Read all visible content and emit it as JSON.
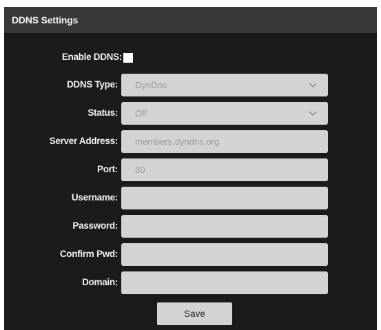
{
  "header": {
    "title": "DDNS Settings"
  },
  "form": {
    "enable_ddns": {
      "label": "Enable DDNS:",
      "checked": false
    },
    "ddns_type": {
      "label": "DDNS Type:",
      "value": "DynDns"
    },
    "status": {
      "label": "Status:",
      "value": "Off"
    },
    "server_address": {
      "label": "Server Address:",
      "value": "members.dyndns.org"
    },
    "port": {
      "label": "Port:",
      "value": "80"
    },
    "username": {
      "label": "Username:",
      "value": ""
    },
    "password": {
      "label": "Password:",
      "value": ""
    },
    "confirm_pwd": {
      "label": "Confirm Pwd:",
      "value": ""
    },
    "domain": {
      "label": "Domain:",
      "value": ""
    }
  },
  "actions": {
    "save_label": "Save"
  },
  "icons": {
    "dropdown": "chevron-down-icon"
  },
  "colors": {
    "panel_bg": "#1b1b1b",
    "header_bg": "#383838",
    "field_bg": "#d3d3d3",
    "label_text": "#f2f2f2",
    "field_text": "#9a9a9a"
  }
}
